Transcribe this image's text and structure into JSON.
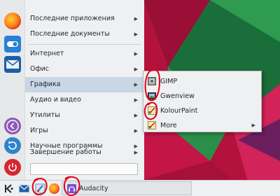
{
  "menu": {
    "items": [
      {
        "label": "Последние приложения",
        "has_submenu": true
      },
      {
        "label": "Последние документы",
        "has_submenu": true
      },
      {
        "label": "Интернет",
        "has_submenu": true
      },
      {
        "label": "Офис",
        "has_submenu": true
      },
      {
        "label": "Графика",
        "has_submenu": true
      },
      {
        "label": "Аудио и видео",
        "has_submenu": true
      },
      {
        "label": "Утилиты",
        "has_submenu": true
      },
      {
        "label": "Игры",
        "has_submenu": true
      },
      {
        "label": "Научные программы",
        "has_submenu": true
      },
      {
        "label": "Завершение работы",
        "has_submenu": true
      }
    ],
    "active_item": "Графика",
    "search_value": ""
  },
  "favorites": [
    {
      "icon": "firefox-icon"
    },
    {
      "icon": "toggle-settings-icon"
    },
    {
      "icon": "mail-icon"
    },
    {
      "icon": "back-arrow-icon"
    },
    {
      "icon": "refresh-icon"
    },
    {
      "icon": "power-icon"
    }
  ],
  "submenu": {
    "items": [
      {
        "label": "GIMP",
        "icon": "gimp-icon"
      },
      {
        "label": "Gwenview",
        "icon": "gwenview-icon"
      },
      {
        "label": "KolourPaint",
        "icon": "kolourpaint-icon"
      },
      {
        "label": "More",
        "icon": "more-icon",
        "has_submenu": true
      }
    ]
  },
  "taskbar": {
    "launchers": [
      "kde-menu-icon",
      "mail-icon",
      "kolourpaint-icon",
      "firefox-icon"
    ],
    "tasks": [
      {
        "label": "Audacity",
        "icon": "audacity-icon"
      }
    ]
  },
  "colors": {
    "menu_bg": "#eff0f1",
    "active_item": "#c8d6e6",
    "annotation": "#e0001a",
    "wallpaper_red": "#b3123c",
    "wallpaper_green": "#1e7b3c"
  }
}
